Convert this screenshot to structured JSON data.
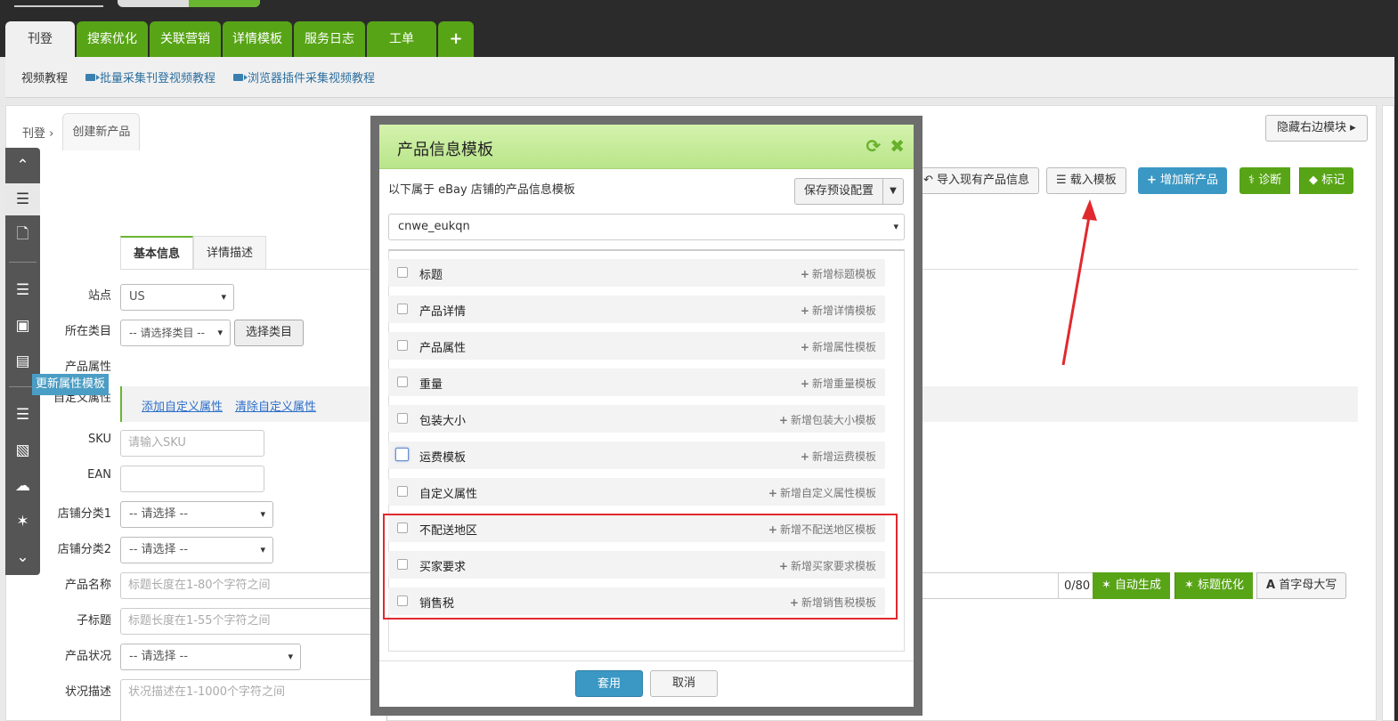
{
  "main_tabs": [
    "刊登",
    "搜索优化",
    "关联营销",
    "详情模板",
    "服务日志",
    "工单",
    "+"
  ],
  "subbar": {
    "label": "视频教程",
    "links": [
      "批量采集刊登视频教程",
      "浏览器插件采集视频教程"
    ]
  },
  "breadcrumb": {
    "root": "刊登",
    "current": "创建新产品"
  },
  "hide_right_button": "隐藏右边模块 ▸",
  "toolbar_buttons": {
    "import": "导入现有产品信息",
    "load_template": "载入模板",
    "add_product": "增加新产品",
    "diagnose": "诊断",
    "mark": "标记"
  },
  "form_tabs": [
    "基本信息",
    "详情描述"
  ],
  "form": {
    "site_label": "站点",
    "site_value": "US",
    "category_label": "所在类目",
    "category_placeholder": "-- 请选择类目 --",
    "category_button": "选择类目",
    "attr_label": "产品属性",
    "attr_tooltip": "更新属性模板",
    "custom_attr_label": "自定义属性",
    "add_custom_attr": "添加自定义属性",
    "clear_custom_attr": "清除自定义属性",
    "sku_label": "SKU",
    "sku_placeholder": "请输入SKU",
    "ean_label": "EAN",
    "shop_cat1_label": "店铺分类1",
    "shop_cat2_label": "店铺分类2",
    "select_placeholder": "-- 请选择 --",
    "name_label": "产品名称",
    "name_placeholder": "标题长度在1-80个字符之间",
    "name_counter": "0/80",
    "auto_generate": "自动生成",
    "title_optimize": "标题优化",
    "capitalize": "首字母大写",
    "subtitle_label": "子标题",
    "subtitle_placeholder": "标题长度在1-55个字符之间",
    "condition_label": "产品状况",
    "condition_desc_label": "状况描述",
    "condition_desc_placeholder": "状况描述在1-1000个字符之间"
  },
  "dialog": {
    "title": "产品信息模板",
    "subtitle": "以下属于 eBay 店铺的产品信息模板",
    "save_preset": "保存预设配置",
    "shop_value": "cnwe_eukqn",
    "templates": [
      {
        "name": "标题",
        "add": "新增标题模板"
      },
      {
        "name": "产品详情",
        "add": "新增详情模板"
      },
      {
        "name": "产品属性",
        "add": "新增属性模板"
      },
      {
        "name": "重量",
        "add": "新增重量模板"
      },
      {
        "name": "包装大小",
        "add": "新增包装大小模板"
      },
      {
        "name": "运费模板",
        "add": "新增运费模板"
      },
      {
        "name": "自定义属性",
        "add": "新增自定义属性模板"
      },
      {
        "name": "不配送地区",
        "add": "新增不配送地区模板"
      },
      {
        "name": "买家要求",
        "add": "新增买家要求模板"
      },
      {
        "name": "销售税",
        "add": "新增销售税模板"
      }
    ],
    "apply": "套用",
    "cancel": "取消"
  },
  "colors": {
    "tab_green": "#58a417",
    "dialog_header": "#c8eca0",
    "highlight_red": "#e0292e",
    "button_blue": "#3b98c4"
  }
}
